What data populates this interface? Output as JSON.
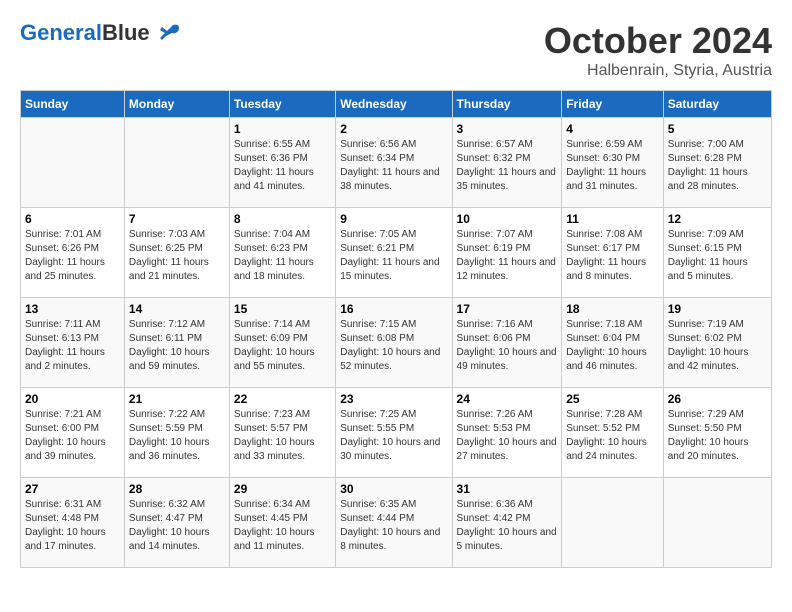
{
  "logo": {
    "general": "General",
    "blue": "Blue"
  },
  "header": {
    "month": "October 2024",
    "location": "Halbenrain, Styria, Austria"
  },
  "days_of_week": [
    "Sunday",
    "Monday",
    "Tuesday",
    "Wednesday",
    "Thursday",
    "Friday",
    "Saturday"
  ],
  "weeks": [
    [
      {
        "num": "",
        "empty": true
      },
      {
        "num": "",
        "empty": true
      },
      {
        "num": "1",
        "sunrise": "6:55 AM",
        "sunset": "6:36 PM",
        "daylight": "11 hours and 41 minutes."
      },
      {
        "num": "2",
        "sunrise": "6:56 AM",
        "sunset": "6:34 PM",
        "daylight": "11 hours and 38 minutes."
      },
      {
        "num": "3",
        "sunrise": "6:57 AM",
        "sunset": "6:32 PM",
        "daylight": "11 hours and 35 minutes."
      },
      {
        "num": "4",
        "sunrise": "6:59 AM",
        "sunset": "6:30 PM",
        "daylight": "11 hours and 31 minutes."
      },
      {
        "num": "5",
        "sunrise": "7:00 AM",
        "sunset": "6:28 PM",
        "daylight": "11 hours and 28 minutes."
      }
    ],
    [
      {
        "num": "6",
        "sunrise": "7:01 AM",
        "sunset": "6:26 PM",
        "daylight": "11 hours and 25 minutes."
      },
      {
        "num": "7",
        "sunrise": "7:03 AM",
        "sunset": "6:25 PM",
        "daylight": "11 hours and 21 minutes."
      },
      {
        "num": "8",
        "sunrise": "7:04 AM",
        "sunset": "6:23 PM",
        "daylight": "11 hours and 18 minutes."
      },
      {
        "num": "9",
        "sunrise": "7:05 AM",
        "sunset": "6:21 PM",
        "daylight": "11 hours and 15 minutes."
      },
      {
        "num": "10",
        "sunrise": "7:07 AM",
        "sunset": "6:19 PM",
        "daylight": "11 hours and 12 minutes."
      },
      {
        "num": "11",
        "sunrise": "7:08 AM",
        "sunset": "6:17 PM",
        "daylight": "11 hours and 8 minutes."
      },
      {
        "num": "12",
        "sunrise": "7:09 AM",
        "sunset": "6:15 PM",
        "daylight": "11 hours and 5 minutes."
      }
    ],
    [
      {
        "num": "13",
        "sunrise": "7:11 AM",
        "sunset": "6:13 PM",
        "daylight": "11 hours and 2 minutes."
      },
      {
        "num": "14",
        "sunrise": "7:12 AM",
        "sunset": "6:11 PM",
        "daylight": "10 hours and 59 minutes."
      },
      {
        "num": "15",
        "sunrise": "7:14 AM",
        "sunset": "6:09 PM",
        "daylight": "10 hours and 55 minutes."
      },
      {
        "num": "16",
        "sunrise": "7:15 AM",
        "sunset": "6:08 PM",
        "daylight": "10 hours and 52 minutes."
      },
      {
        "num": "17",
        "sunrise": "7:16 AM",
        "sunset": "6:06 PM",
        "daylight": "10 hours and 49 minutes."
      },
      {
        "num": "18",
        "sunrise": "7:18 AM",
        "sunset": "6:04 PM",
        "daylight": "10 hours and 46 minutes."
      },
      {
        "num": "19",
        "sunrise": "7:19 AM",
        "sunset": "6:02 PM",
        "daylight": "10 hours and 42 minutes."
      }
    ],
    [
      {
        "num": "20",
        "sunrise": "7:21 AM",
        "sunset": "6:00 PM",
        "daylight": "10 hours and 39 minutes."
      },
      {
        "num": "21",
        "sunrise": "7:22 AM",
        "sunset": "5:59 PM",
        "daylight": "10 hours and 36 minutes."
      },
      {
        "num": "22",
        "sunrise": "7:23 AM",
        "sunset": "5:57 PM",
        "daylight": "10 hours and 33 minutes."
      },
      {
        "num": "23",
        "sunrise": "7:25 AM",
        "sunset": "5:55 PM",
        "daylight": "10 hours and 30 minutes."
      },
      {
        "num": "24",
        "sunrise": "7:26 AM",
        "sunset": "5:53 PM",
        "daylight": "10 hours and 27 minutes."
      },
      {
        "num": "25",
        "sunrise": "7:28 AM",
        "sunset": "5:52 PM",
        "daylight": "10 hours and 24 minutes."
      },
      {
        "num": "26",
        "sunrise": "7:29 AM",
        "sunset": "5:50 PM",
        "daylight": "10 hours and 20 minutes."
      }
    ],
    [
      {
        "num": "27",
        "sunrise": "6:31 AM",
        "sunset": "4:48 PM",
        "daylight": "10 hours and 17 minutes."
      },
      {
        "num": "28",
        "sunrise": "6:32 AM",
        "sunset": "4:47 PM",
        "daylight": "10 hours and 14 minutes."
      },
      {
        "num": "29",
        "sunrise": "6:34 AM",
        "sunset": "4:45 PM",
        "daylight": "10 hours and 11 minutes."
      },
      {
        "num": "30",
        "sunrise": "6:35 AM",
        "sunset": "4:44 PM",
        "daylight": "10 hours and 8 minutes."
      },
      {
        "num": "31",
        "sunrise": "6:36 AM",
        "sunset": "4:42 PM",
        "daylight": "10 hours and 5 minutes."
      },
      {
        "num": "",
        "empty": true
      },
      {
        "num": "",
        "empty": true
      }
    ]
  ]
}
